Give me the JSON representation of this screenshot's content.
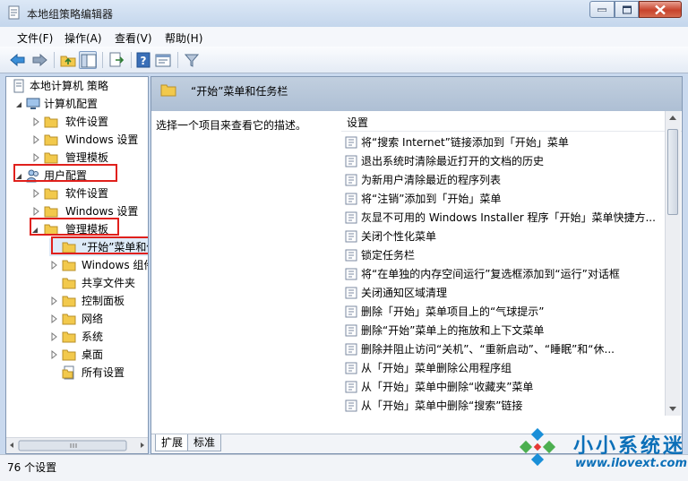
{
  "window": {
    "title": "本地组策略编辑器"
  },
  "menu": [
    "文件(F)",
    "操作(A)",
    "查看(V)",
    "帮助(H)"
  ],
  "tree": {
    "root": "本地计算机 策略",
    "computer_config": "计算机配置",
    "computer_children": [
      "软件设置",
      "Windows 设置",
      "管理模板"
    ],
    "user_config": "用户配置",
    "user_children": [
      "软件设置",
      "Windows 设置"
    ],
    "admin_templates": "管理模板",
    "admin_children": [
      "“开始”菜单和任务栏",
      "Windows 组件",
      "共享文件夹",
      "控制面板",
      "网络",
      "系统",
      "桌面",
      "所有设置"
    ]
  },
  "right_pane": {
    "header_title": "“开始”菜单和任务栏",
    "description": "选择一个项目来查看它的描述。",
    "column_header": "设置",
    "settings": [
      "将“搜索 Internet”链接添加到「开始」菜单",
      "退出系统时清除最近打开的文档的历史",
      "为新用户清除最近的程序列表",
      "将“注销”添加到「开始」菜单",
      "灰显不可用的 Windows Installer 程序「开始」菜单快捷方...",
      "关闭个性化菜单",
      "锁定任务栏",
      "将“在单独的内存空间运行”复选框添加到“运行”对话框",
      "关闭通知区域清理",
      "删除「开始」菜单项目上的“气球提示”",
      "删除“开始”菜单上的拖放和上下文菜单",
      "删除并阻止访问“关机”、“重新启动”、“睡眠”和“休...",
      "从「开始」菜单删除公用程序组",
      "从「开始」菜单中删除“收藏夹”菜单",
      "从「开始」菜单中删除“搜索”链接"
    ],
    "tabs": [
      "扩展",
      "标准"
    ]
  },
  "status": "76 个设置",
  "watermark": {
    "text": "小小系统迷",
    "url": "www.ilovext.com"
  },
  "colors": {
    "highlight_red": "#e0201c",
    "folder_yellow": "#f2c94c",
    "watermark_blue": "#0b6fb8"
  }
}
